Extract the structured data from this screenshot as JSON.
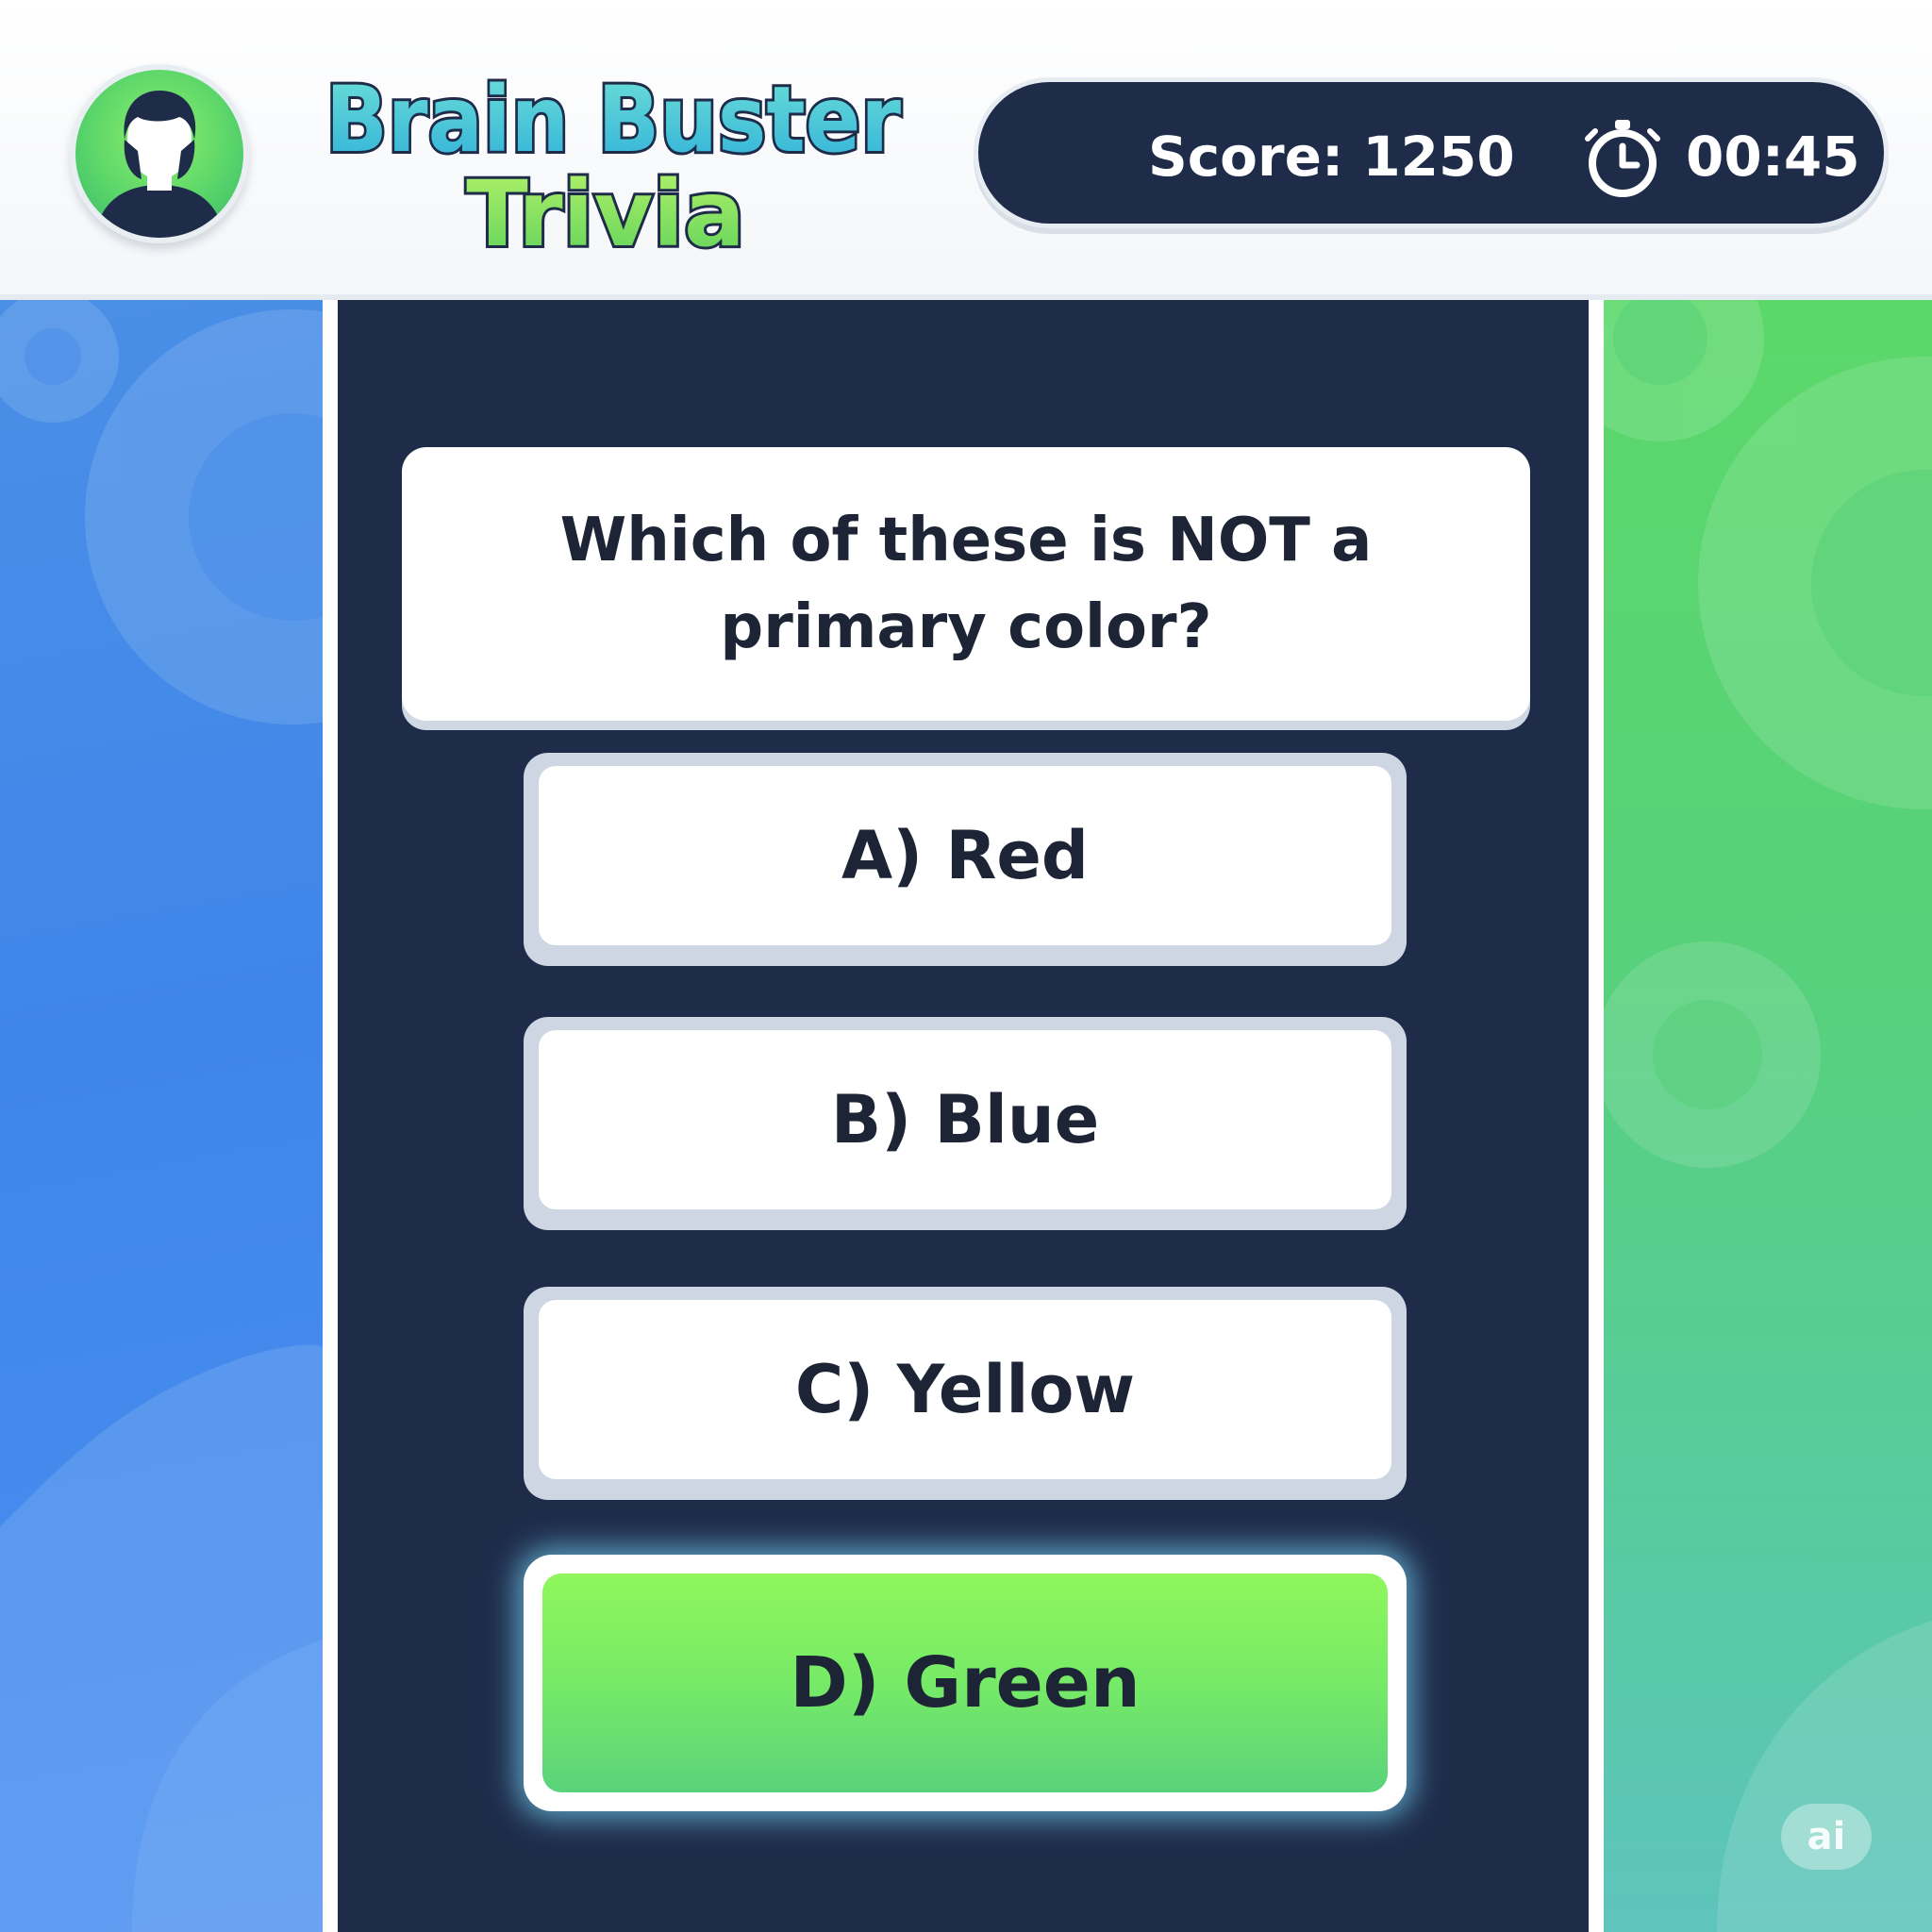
{
  "header": {
    "avatar_icon": "user-avatar-icon",
    "title_line1": "Brain Buster",
    "title_line2": "Trivia",
    "score_text": "Score: 1250",
    "timer_icon": "stopwatch-icon",
    "timer_text": "00:45"
  },
  "question": {
    "line1": "Which of these is NOT a",
    "line2": "primary color?"
  },
  "answers": [
    {
      "label": "A) Red",
      "selected": false
    },
    {
      "label": "B) Blue",
      "selected": false
    },
    {
      "label": "C) Yellow",
      "selected": false
    },
    {
      "label": "D) Green",
      "selected": true
    }
  ],
  "badge": {
    "text": "ai"
  },
  "colors": {
    "navy": "#1e2c4a",
    "blue_side": "#3f86ea",
    "green_side": "#5cd86a",
    "highlight_green": "#7cec62",
    "title_blue": "#3fc3d9",
    "title_green": "#8ee85a"
  }
}
